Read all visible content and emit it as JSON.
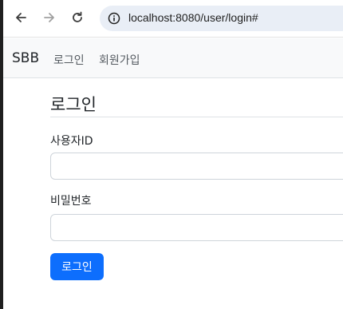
{
  "browser": {
    "url": "localhost:8080/user/login#"
  },
  "navbar": {
    "brand": "SBB",
    "links": [
      "로그인",
      "회원가입"
    ]
  },
  "form": {
    "title": "로그인",
    "username_label": "사용자ID",
    "username_value": "",
    "password_label": "비밀번호",
    "password_value": "",
    "submit_label": "로그인"
  },
  "colors": {
    "primary": "#0d6efd",
    "navbar_bg": "#f8f9fa",
    "address_bar_bg": "#e9eef6"
  }
}
